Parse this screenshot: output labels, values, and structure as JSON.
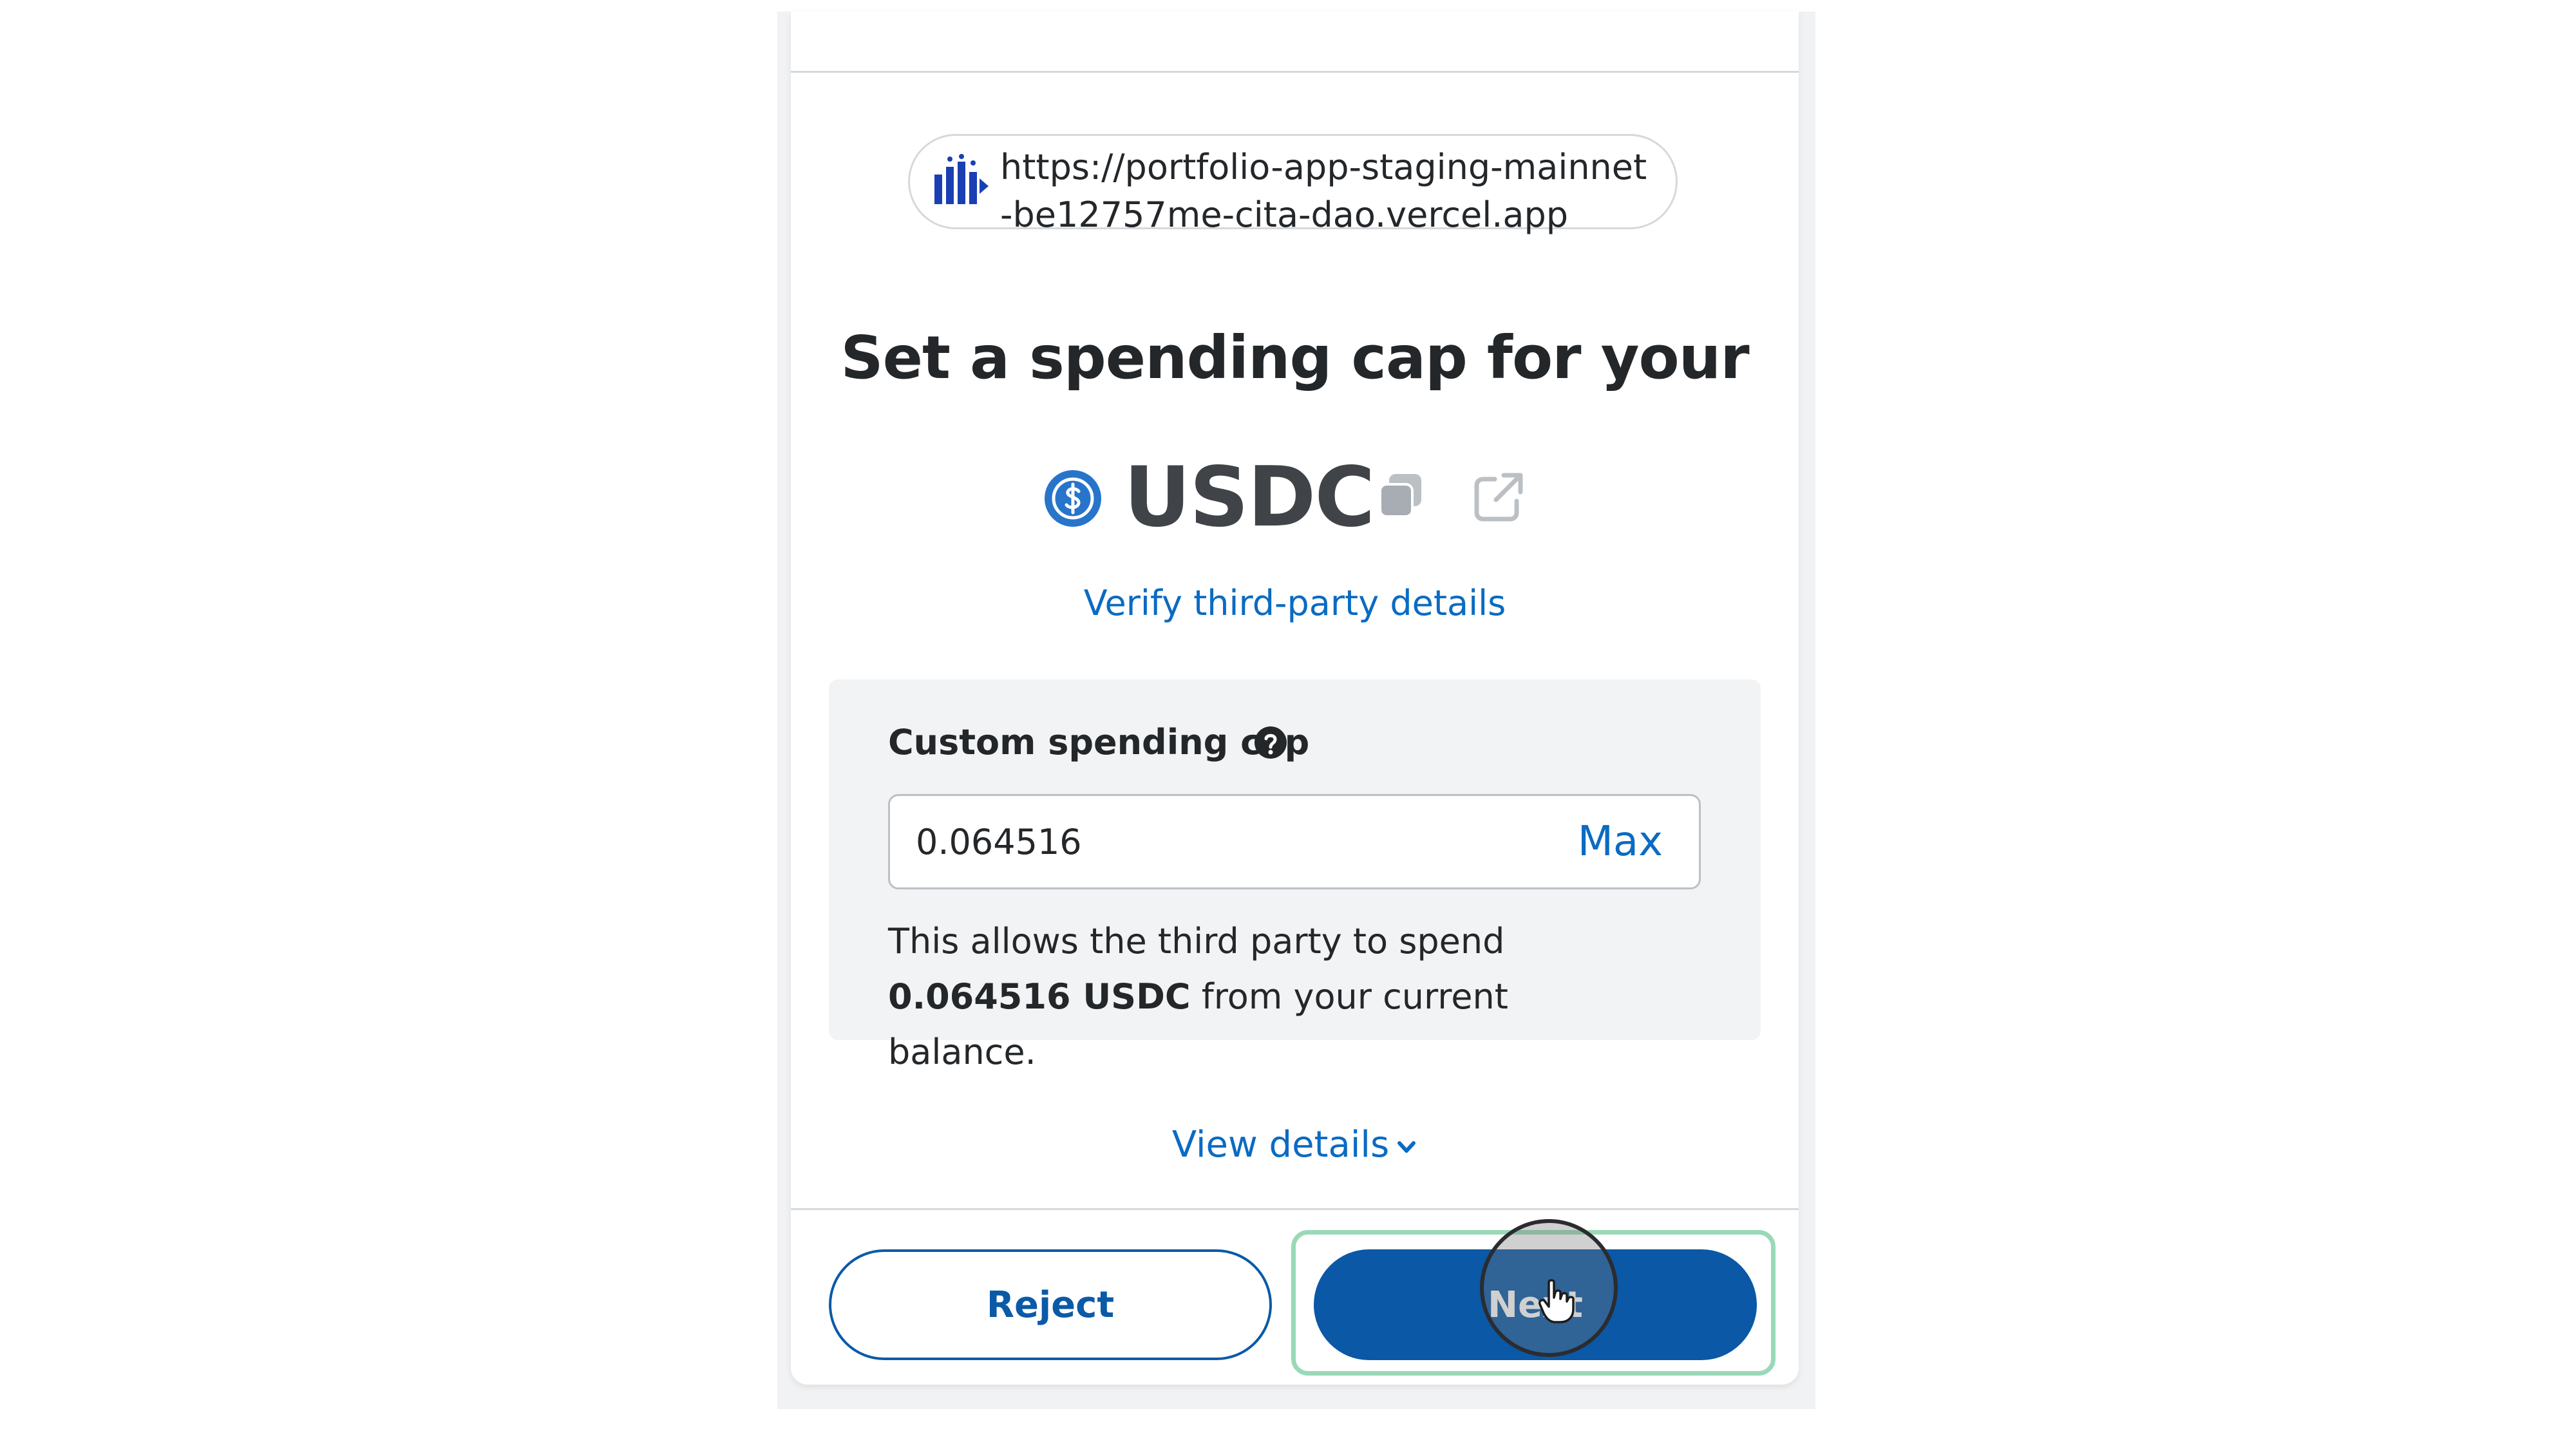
{
  "origin": {
    "url": "https://portfolio-app-staging-mainnet-be12757me-cita-dao.vercel.app"
  },
  "title": "Set a spending cap for your",
  "token": {
    "symbol": "USDC"
  },
  "verify_link": "Verify third-party details",
  "custom_cap": {
    "label": "Custom spending cap",
    "value": "0.064516",
    "max_label": "Max",
    "desc_prefix": "This allows the third party to spend ",
    "desc_amount": "0.064516 USDC",
    "desc_suffix": " from your current balance."
  },
  "view_details": "View details",
  "buttons": {
    "reject": "Reject",
    "next": "Next"
  },
  "colors": {
    "link": "#0a6bc2",
    "primary": "#0a58a6",
    "focus": "#9ad9b7"
  }
}
